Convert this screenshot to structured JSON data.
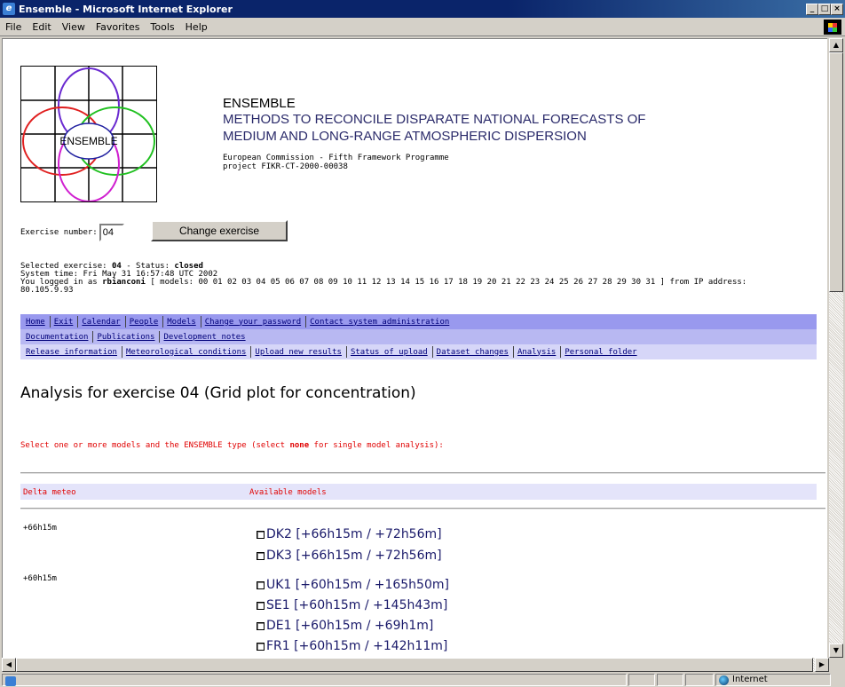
{
  "window": {
    "title": "Ensemble - Microsoft Internet Explorer",
    "controls": [
      "_",
      "□",
      "×"
    ]
  },
  "menu": [
    {
      "key": "F",
      "rest": "ile"
    },
    {
      "key": "E",
      "rest": "dit"
    },
    {
      "key": "V",
      "rest": "iew"
    },
    {
      "key": "F",
      "rest": "avorites",
      "pre": ""
    },
    {
      "key": "T",
      "rest": "ools"
    },
    {
      "key": "H",
      "rest": "elp"
    }
  ],
  "menu_labels": [
    "File",
    "Edit",
    "View",
    "Favorites",
    "Tools",
    "Help"
  ],
  "header": {
    "logo_text": "ENSEMBLE",
    "title": "ENSEMBLE",
    "subtitle_line1": "METHODS TO RECONCILE DISPARATE NATIONAL FORECASTS OF",
    "subtitle_line2": "MEDIUM AND LONG-RANGE ATMOSPHERIC DISPERSION",
    "funding_line1": "European Commission - Fifth Framework Programme",
    "funding_line2": "project FIKR-CT-2000-00038"
  },
  "exercise": {
    "label": "Exercise number:",
    "value": "04",
    "button_label": "Change exercise"
  },
  "session": {
    "selected_prefix": "Selected exercise: ",
    "selected_exercise": "04",
    "status_prefix": " - Status: ",
    "status": "closed",
    "system_time": "System time: Fri May 31 16:57:48 UTC 2002",
    "logged_prefix": "You logged in as ",
    "user": "rbianconi",
    "logged_suffix": " [ models: 00 01 02 03 04 05 06 07 08 09 10 11 12 13 14 15 16 17 18 19 20 21 22 23 24 25 26 27 28 29 30 31 ] from IP address:",
    "ip": "80.105.9.93"
  },
  "nav": {
    "row1": [
      "Home",
      "Exit",
      "Calendar",
      "People",
      "Models",
      "Change your password",
      "Contact system administration"
    ],
    "row2": [
      "Documentation",
      "Publications",
      "Development notes"
    ],
    "row3": [
      "Release information",
      "Meteorological conditions",
      "Upload new results",
      "Status of upload",
      "Dataset changes",
      "Analysis",
      "Personal folder"
    ]
  },
  "page_title": "Analysis for exercise 04 (Grid plot for concentration)",
  "instruction": {
    "before": "Select one or more models and the ENSEMBLE type (select ",
    "bold": "none",
    "after": " for single model analysis):"
  },
  "table": {
    "col_delta": "Delta meteo",
    "col_models": "Available models",
    "groups": [
      {
        "delta": "+66h15m",
        "models": [
          "DK2 [+66h15m / +72h56m]",
          "DK3 [+66h15m / +72h56m]"
        ]
      },
      {
        "delta": "+60h15m",
        "models": [
          "UK1 [+60h15m / +165h50m]",
          "SE1 [+60h15m / +145h43m]",
          "DE1 [+60h15m / +69h1m]",
          "FR1 [+60h15m / +142h11m]"
        ]
      }
    ]
  },
  "status": {
    "zone": "Internet"
  },
  "colors": {
    "nav_row1": "#9999ee",
    "nav_row2": "#b8b8f2",
    "nav_row3": "#d6d6f8",
    "link": "#00007a",
    "instruction": "#e00000",
    "titlebar": "#0a246a"
  }
}
